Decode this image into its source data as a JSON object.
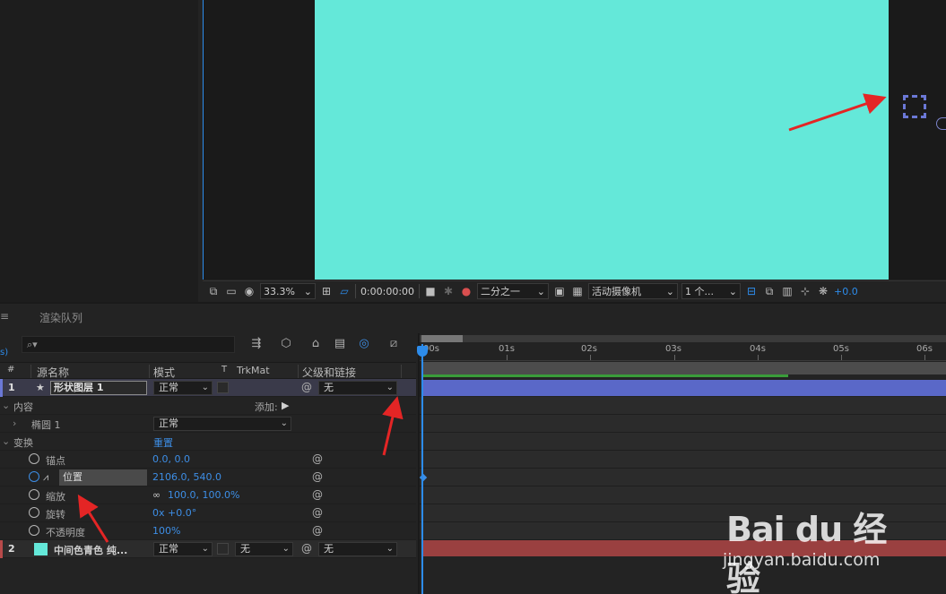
{
  "viewer": {
    "zoom": "33.3%",
    "timecode": "0:00:00:00",
    "resolution": "二分之一",
    "camera": "活动摄像机",
    "views": "1 个...",
    "exposure": "+0.0",
    "canvas_color": "#64e8d9",
    "accent_color": "#2d8ceb"
  },
  "tabs": {
    "menu_glyph": "≡",
    "render_queue": "渲染队列"
  },
  "search": {
    "placeholder": "⌕▾",
    "left_hint": "s)"
  },
  "timeline_tools": [
    "tree-icon",
    "3d-cube-icon",
    "comp-flowchart-icon",
    "frame-blend-icon",
    "motion-blur-icon",
    "graph-editor-icon"
  ],
  "columns": {
    "num": "#",
    "source_name": "源名称",
    "mode": "模式",
    "t": "T",
    "trkmat": "TrkMat",
    "parent": "父级和链接"
  },
  "layers": [
    {
      "index": "1",
      "name": "形状图层 1",
      "mode": "正常",
      "parent": "无"
    },
    {
      "index": "2",
      "name": "中间色青色 纯...",
      "mode": "正常",
      "trkmat": "无",
      "parent": "无",
      "swatch": "#64e8d9"
    }
  ],
  "properties": {
    "contents": "内容",
    "add_label": "添加:",
    "ellipse": "椭圆 1",
    "ellipse_mode": "正常",
    "transform": "变换",
    "reset": "重置",
    "anchor_label": "锚点",
    "anchor_value": "0.0, 0.0",
    "position_label": "位置",
    "position_value": "2106.0, 540.0",
    "scale_label": "缩放",
    "scale_value": "100.0, 100.0%",
    "rotation_label": "旋转",
    "rotation_value": "0x +0.0°",
    "opacity_label": "不透明度",
    "opacity_value": "100%"
  },
  "ruler": {
    "labels": [
      "00s",
      "01s",
      "02s",
      "03s",
      "04s",
      "05s",
      "06s"
    ]
  },
  "watermark": {
    "logo": "Bai du 经验",
    "url": "jingyan.baidu.com"
  }
}
